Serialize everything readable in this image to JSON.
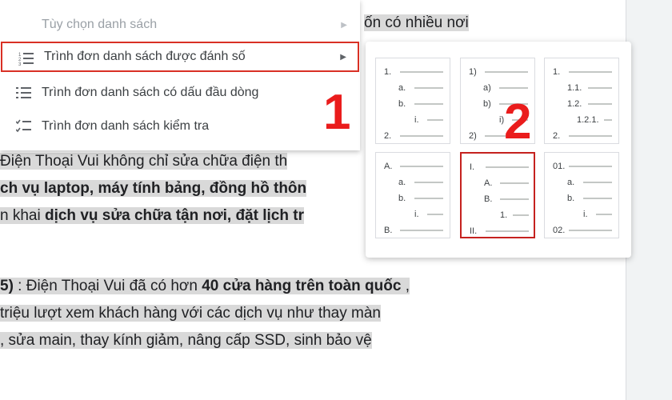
{
  "menu": {
    "items": [
      {
        "label": "Tùy chọn danh sách",
        "icon": "none",
        "disabled": true,
        "submenu": true
      },
      {
        "label": "Trình đơn danh sách được đánh số",
        "icon": "numbered-list-icon",
        "disabled": false,
        "submenu": true
      },
      {
        "label": "Trình đơn danh sách có dấu đầu dòng",
        "icon": "bulleted-list-icon",
        "disabled": false,
        "submenu": false
      },
      {
        "label": "Trình đơn danh sách kiểm tra",
        "icon": "checklist-icon",
        "disabled": false,
        "submenu": false
      }
    ]
  },
  "document": {
    "line0": "ốn có nhiều nơi",
    "line1_a": "Điện Thoại Vui không chỉ sửa chữa điện th",
    "line2_a": "ch vụ laptop, máy tính bảng, đồng hồ thôn",
    "line3_a": "n khai ",
    "line3_b": "dịch vụ sửa chữa tận nơi, đặt lịch tr",
    "line4_a": "5)",
    "line4_b": " : Điện Thoại Vui đã có hơn ",
    "line4_c": "40 cửa hàng trên toàn quốc",
    "line4_d": " ,",
    "line5": " triệu lượt xem khách hàng với các dịch vụ như thay màn",
    "line6": ", sửa main, thay kính giảm, nâng cấp SSD, sinh bảo vệ"
  },
  "numbered_styles": [
    {
      "name": "number-dot-alpha-roman",
      "markers": [
        "1.",
        "a.",
        "b.",
        "i.",
        "2."
      ]
    },
    {
      "name": "number-paren",
      "markers": [
        "1)",
        "a)",
        "b)",
        "i)",
        "2)"
      ]
    },
    {
      "name": "decimal-outline",
      "markers": [
        "1.",
        "1.1.",
        "1.2.",
        "1.2.1.",
        "2."
      ]
    },
    {
      "name": "upper-alpha",
      "markers": [
        "A.",
        "a.",
        "b.",
        "i.",
        "B."
      ]
    },
    {
      "name": "upper-roman",
      "markers": [
        "I.",
        "A.",
        "B.",
        "1.",
        "II."
      ]
    },
    {
      "name": "leading-zero",
      "markers": [
        "01.",
        "a.",
        "b.",
        "i.",
        "02."
      ]
    }
  ],
  "callouts": {
    "one": "1",
    "two": "2"
  },
  "colors": {
    "highlight": "#d9d9d9",
    "annotation_red": "#ea1c1c",
    "selection_border": "#d93025"
  }
}
